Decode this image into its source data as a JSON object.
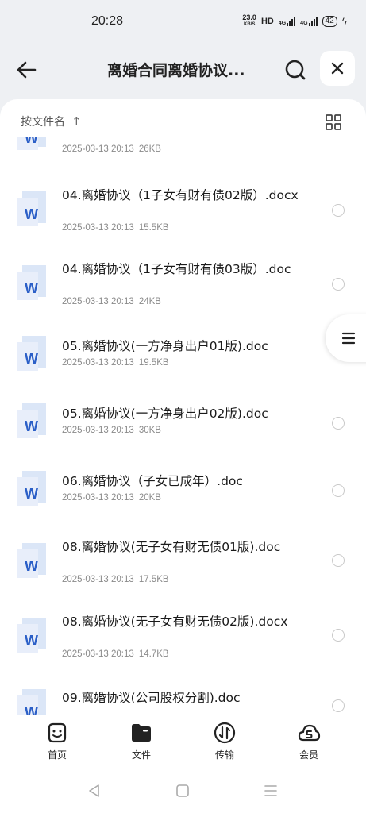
{
  "status": {
    "time": "20:28",
    "net_speed_value": "23.0",
    "net_speed_unit": "KB/S",
    "hd": "HD",
    "signal1": "4G",
    "signal2": "4G",
    "battery": "42"
  },
  "header": {
    "title": "离婚合同离婚协议..."
  },
  "toolbar": {
    "sort_label": "按文件名",
    "sort_arrow": "↑"
  },
  "files": [
    {
      "name": "",
      "date": "2025-03-13 20:13",
      "size": "26KB"
    },
    {
      "name": "04.离婚协议（1子女有财有债02版）.docx",
      "date": "2025-03-13 20:13",
      "size": "15.5KB"
    },
    {
      "name": "04.离婚协议（1子女有财有债03版）.doc",
      "date": "2025-03-13 20:13",
      "size": "24KB"
    },
    {
      "name": "05.离婚协议(一方净身出户01版).doc",
      "date": "2025-03-13 20:13",
      "size": "19.5KB"
    },
    {
      "name": "05.离婚协议(一方净身出户02版).doc",
      "date": "2025-03-13 20:13",
      "size": "30KB"
    },
    {
      "name": "06.离婚协议（子女已成年）.doc",
      "date": "2025-03-13 20:13",
      "size": "20KB"
    },
    {
      "name": "08.离婚协议(无子女有财无债01版).doc",
      "date": "2025-03-13 20:13",
      "size": "17.5KB"
    },
    {
      "name": "08.离婚协议(无子女有财无债02版).docx",
      "date": "2025-03-13 20:13",
      "size": "14.7KB"
    },
    {
      "name": "09.离婚协议(公司股权分割).doc",
      "date": "",
      "size": ""
    }
  ],
  "nav": {
    "home": "首页",
    "files": "文件",
    "transfer": "传输",
    "member": "会员"
  },
  "colors": {
    "word_blue": "#2b5fc7",
    "word_light": "#dbe6f7"
  }
}
